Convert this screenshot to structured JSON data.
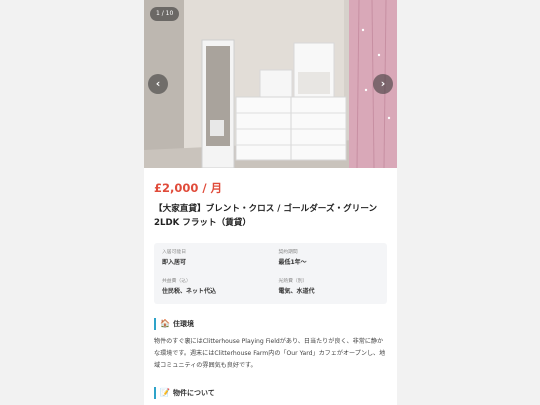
{
  "gallery": {
    "counter": "1 / 10",
    "prev_icon": "‹",
    "next_icon": "›"
  },
  "listing": {
    "price": "£2,000 / 月",
    "title": "【大家直貸】ブレント・クロス / ゴールダーズ・グリーン 2LDK フラット（賃貸）"
  },
  "info": [
    {
      "label": "入居可能日",
      "value": "即入居可"
    },
    {
      "label": "契約期間",
      "value": "最低1年〜"
    },
    {
      "label": "共益費（込）",
      "value": "住民税、ネット代込"
    },
    {
      "label": "光熱費（別）",
      "value": "電気、水道代"
    }
  ],
  "sections": {
    "environment": {
      "icon": "🏠",
      "title": "住環境",
      "text": "物件のすぐ裏にはClitterhouse Playing Fieldがあり、日当たりが良く、非常に静かな環境です。週末にはClitterhouse Farm内の「Our Yard」カフェがオープンし、地域コミュニティの雰囲気も良好です。"
    },
    "about": {
      "icon": "📝",
      "title": "物件について"
    }
  },
  "colors": {
    "price": "#e04b3a",
    "section_accent": "#2ea3c9"
  }
}
